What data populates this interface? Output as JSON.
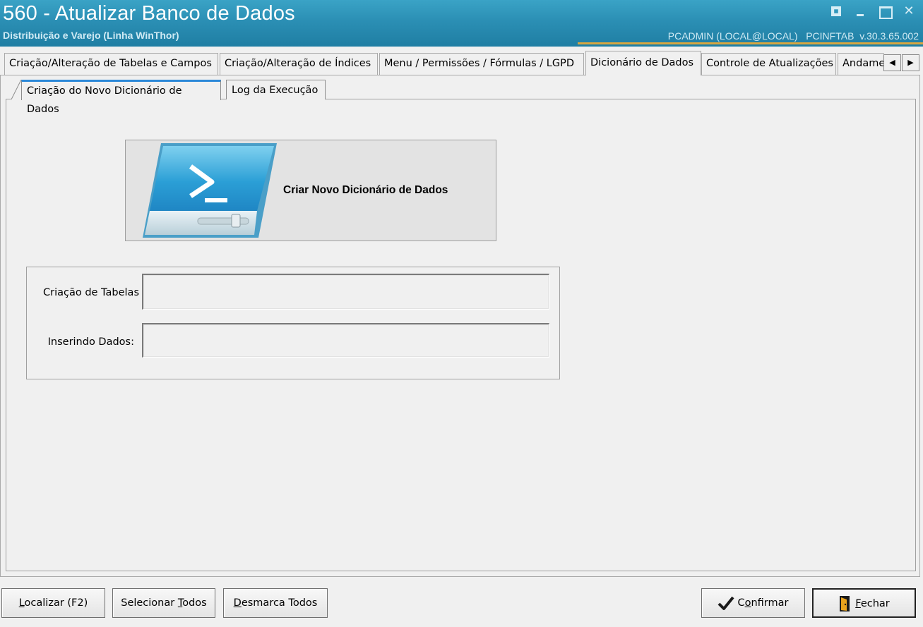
{
  "window": {
    "title": "560 - Atualizar Banco de Dados",
    "subtitle": "Distribuição e Varejo (Linha WinThor)",
    "user_info": "PCADMIN (LOCAL@LOCAL)   PCINFTAB  v.30.3.65.002",
    "controls": [
      "restore-icon",
      "minimize-icon",
      "maximize-icon",
      "close-icon"
    ]
  },
  "tabs": [
    {
      "label": "Criação/Alteração de Tabelas e Campos"
    },
    {
      "label": "Criação/Alteração de Índices"
    },
    {
      "label": "Menu / Permissões / Fórmulas / LGPD"
    },
    {
      "label": "Dicionário de Dados",
      "active": true
    },
    {
      "label": "Controle de Atualizações"
    },
    {
      "label": "Andame"
    }
  ],
  "subtabs": [
    {
      "label": "Criação do Novo Dicionário de Dados",
      "active": true
    },
    {
      "label": "Log da Execução"
    }
  ],
  "action": {
    "label": "Criar Novo Dicionário de Dados",
    "icon": "powershell-icon"
  },
  "fields": {
    "tables_label": "Criação de Tabelas",
    "insert_label": "Inserindo Dados:"
  },
  "buttons": {
    "locate": {
      "pre": "",
      "u": "L",
      "post": "ocalizar (F2)"
    },
    "select_all": {
      "pre": "Selecionar ",
      "u": "T",
      "post": "odos"
    },
    "unselect_all": {
      "pre": "",
      "u": "D",
      "post": "esmarca Todos"
    },
    "confirm": {
      "pre": "C",
      "u": "o",
      "post": "nfirmar"
    },
    "close": {
      "pre": "",
      "u": "F",
      "post": "echar"
    }
  },
  "colors": {
    "titlebar": "#2b8fb4",
    "accent": "#2b88d8"
  }
}
